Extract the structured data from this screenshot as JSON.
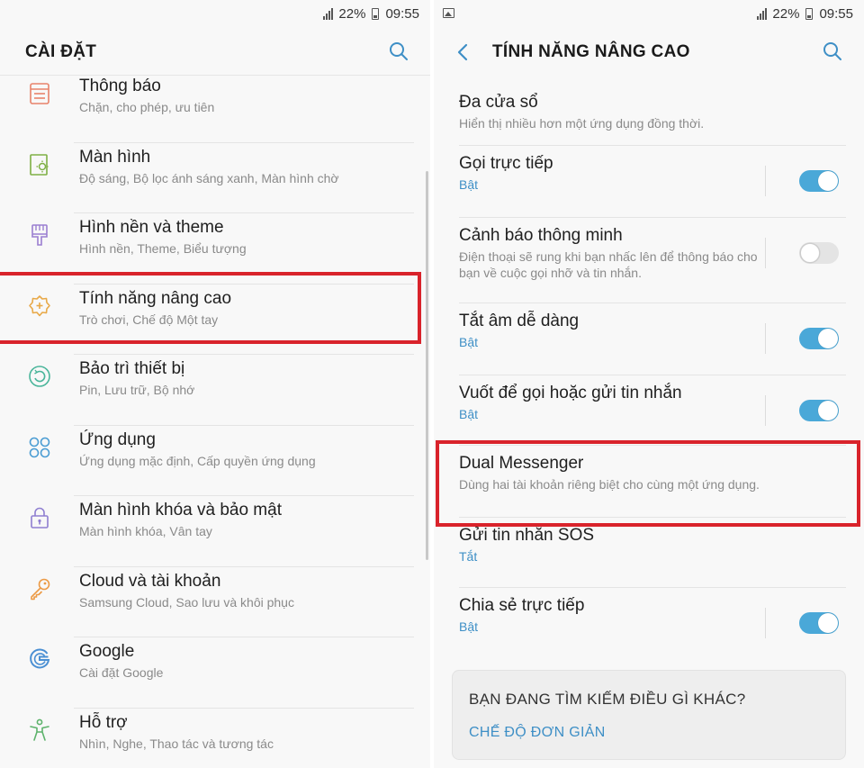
{
  "status": {
    "battery": "22%",
    "time": "09:55"
  },
  "left": {
    "title": "CÀI ĐẶT",
    "items": [
      {
        "label": "Thông báo",
        "sub": "Chặn, cho phép, ưu tiên",
        "icon": "notification-icon"
      },
      {
        "label": "Màn hình",
        "sub": "Độ sáng, Bộ lọc ánh sáng xanh, Màn hình chờ",
        "icon": "display-icon"
      },
      {
        "label": "Hình nền và theme",
        "sub": "Hình nền, Theme, Biểu tượng",
        "icon": "paintbrush-icon"
      },
      {
        "label": "Tính năng nâng cao",
        "sub": "Trò chơi, Chế độ Một tay",
        "icon": "advanced-gear-icon"
      },
      {
        "label": "Bảo trì thiết bị",
        "sub": "Pin, Lưu trữ, Bộ nhớ",
        "icon": "device-care-icon"
      },
      {
        "label": "Ứng dụng",
        "sub": "Ứng dụng mặc định, Cấp quyền ứng dụng",
        "icon": "apps-grid-icon"
      },
      {
        "label": "Màn hình khóa và bảo mật",
        "sub": "Màn hình khóa, Vân tay",
        "icon": "lock-icon"
      },
      {
        "label": "Cloud và tài khoản",
        "sub": "Samsung Cloud, Sao lưu và khôi phục",
        "icon": "key-icon"
      },
      {
        "label": "Google",
        "sub": "Cài đặt Google",
        "icon": "google-icon"
      },
      {
        "label": "Hỗ trợ",
        "sub": "Nhìn, Nghe, Thao tác và tương tác",
        "icon": "accessibility-icon"
      }
    ]
  },
  "right": {
    "title": "TÍNH NĂNG NÂNG CAO",
    "items": [
      {
        "label": "Đa cửa sổ",
        "sub": "Hiển thị nhiều hơn một ứng dụng đồng thời.",
        "accent": false,
        "toggle": null
      },
      {
        "label": "Gọi trực tiếp",
        "sub": "Bật",
        "accent": true,
        "toggle": "on"
      },
      {
        "label": "Cảnh báo thông minh",
        "sub": "Điện thoại sẽ rung khi bạn nhấc lên để thông báo cho bạn về cuộc gọi nhỡ và tin nhắn.",
        "accent": false,
        "toggle": "off"
      },
      {
        "label": "Tắt âm dễ dàng",
        "sub": "Bật",
        "accent": true,
        "toggle": "on"
      },
      {
        "label": "Vuốt để gọi hoặc gửi tin nhắn",
        "sub": "Bật",
        "accent": true,
        "toggle": "on"
      },
      {
        "label": "Dual Messenger",
        "sub": "Dùng hai tài khoản riêng biệt cho cùng một ứng dụng.",
        "accent": false,
        "toggle": null
      },
      {
        "label": "Gửi tin nhắn SOS",
        "sub": "Tắt",
        "accent": true,
        "toggle": null
      },
      {
        "label": "Chia sẻ trực tiếp",
        "sub": "Bật",
        "accent": true,
        "toggle": "on"
      }
    ],
    "suggest": {
      "question": "BẠN ĐANG TÌM KIẾM ĐIỀU GÌ KHÁC?",
      "link": "CHẾ ĐỘ ĐƠN GIẢN"
    }
  },
  "colors": {
    "accent": "#3e8fc6",
    "highlight": "#d9232b",
    "toggle_on": "#4aa8d8"
  }
}
